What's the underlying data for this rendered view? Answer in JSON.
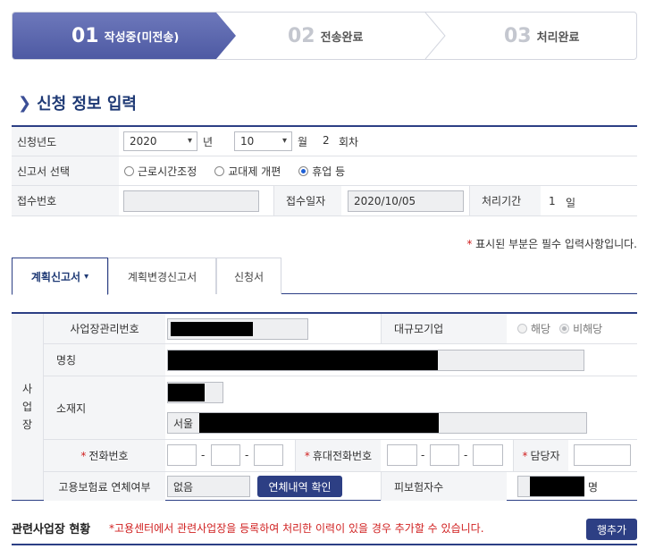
{
  "steps": [
    {
      "num": "01",
      "label": "작성중(미전송)",
      "active": true
    },
    {
      "num": "02",
      "label": "전송완료",
      "active": false
    },
    {
      "num": "03",
      "label": "처리완료",
      "active": false
    }
  ],
  "section_title": "신청 정보 입력",
  "form": {
    "year_label": "신청년도",
    "year_value": "2020",
    "year_unit": "년",
    "month_value": "10",
    "month_unit": "월",
    "round_value": "2",
    "round_unit": "회차",
    "report_select_label": "신고서 선택",
    "report_options": [
      {
        "label": "근로시간조정",
        "checked": false
      },
      {
        "label": "교대제 개편",
        "checked": false
      },
      {
        "label": "휴업 등",
        "checked": true
      }
    ],
    "receipt_no_label": "접수번호",
    "receipt_no_value": "",
    "receipt_date_label": "접수일자",
    "receipt_date_value": "2020/10/05",
    "period_label": "처리기간",
    "period_value": "1",
    "period_unit": "일"
  },
  "required_note": {
    "star": "*",
    "text": "표시된 부분은 필수 입력사항입니다."
  },
  "tabs": [
    {
      "label": "계획신고서",
      "active": true,
      "caret": "▾"
    },
    {
      "label": "계획변경신고서",
      "active": false
    },
    {
      "label": "신청서",
      "active": false
    }
  ],
  "business": {
    "side_label": [
      "사",
      "업",
      "장"
    ],
    "mgmt_no_label": "사업장관리번호",
    "large_company_label": "대규모기업",
    "large_company_options": [
      {
        "label": "해당",
        "checked": false
      },
      {
        "label": "비해당",
        "checked": true
      }
    ],
    "name_label": "명칭",
    "address_label": "소재지",
    "address_prefix": "서울",
    "phone_label": "전화번호",
    "mobile_label": "휴대전화번호",
    "manager_label": "담당자",
    "required_star": "*",
    "dash": "-",
    "insurance_label": "고용보험료 연체여부",
    "insurance_value": "없음",
    "insurance_button": "연체내역 확인",
    "insured_label": "피보험자수",
    "insured_unit": "명"
  },
  "related": {
    "title": "관련사업장 현황",
    "note": "*고용센터에서 관련사업장을 등록하여 처리한 이력이 있을 경우 추가할 수 있습니다.",
    "add_button": "행추가"
  },
  "colors": {
    "navy": "#2c3f85",
    "step_active": "#5a66ad",
    "required": "#d01f1f"
  }
}
